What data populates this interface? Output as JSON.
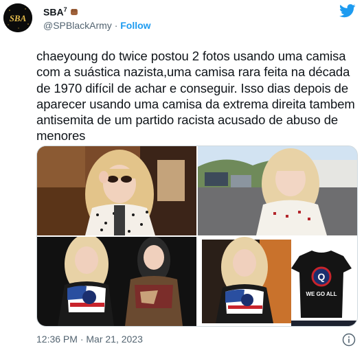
{
  "author": {
    "name": "SBA",
    "superscript": "7",
    "avatar_text": "SBA",
    "handle": "@SPBlackArmy",
    "separator": "·",
    "follow_label": "Follow"
  },
  "tweet": {
    "text": "chaeyoung do twice postou 2 fotos usando uma camisa com a suástica nazista,uma camisa rara feita na década de 1970 difícil de achar e conseguir. Isso dias depois de aparecer usando uma camisa da extrema direita tambem antisemita de um partido racista acusado de abuso de menores",
    "timestamp": "12:36 PM · Mar 21, 2023"
  },
  "media": {
    "shirt_slogan": "WE GO ALL",
    "shirt_letter": "Q"
  },
  "colors": {
    "link": "#1d9bf0",
    "muted": "#536471",
    "text": "#0f1419"
  },
  "icons": [
    "twitter-bird-icon",
    "info-icon",
    "fist-emoji-icon"
  ]
}
